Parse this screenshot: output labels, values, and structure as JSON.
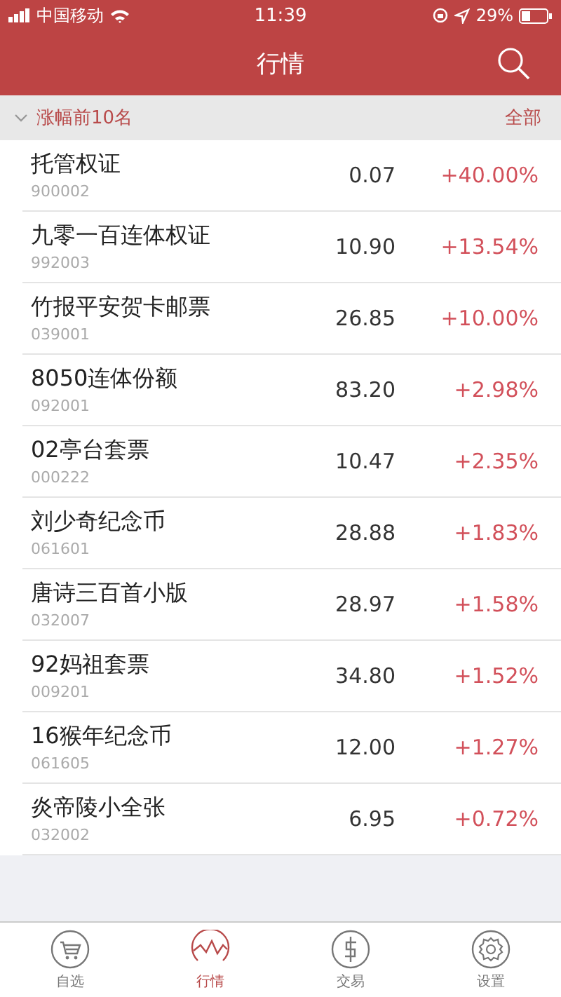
{
  "status_bar": {
    "carrier": "中国移动",
    "time": "11:39",
    "battery": "29%"
  },
  "header": {
    "title": "行情"
  },
  "section": {
    "title": "涨幅前10名",
    "expanded": true,
    "action": "全部"
  },
  "rows": [
    {
      "name": "托管权证",
      "code": "900002",
      "price": "0.07",
      "change": "+40.00%"
    },
    {
      "name": "九零一百连体权证",
      "code": "992003",
      "price": "10.90",
      "change": "+13.54%"
    },
    {
      "name": "竹报平安贺卡邮票",
      "code": "039001",
      "price": "26.85",
      "change": "+10.00%"
    },
    {
      "name": "8050连体份额",
      "code": "092001",
      "price": "83.20",
      "change": "+2.98%"
    },
    {
      "name": "02亭台套票",
      "code": "000222",
      "price": "10.47",
      "change": "+2.35%"
    },
    {
      "name": "刘少奇纪念币",
      "code": "061601",
      "price": "28.88",
      "change": "+1.83%"
    },
    {
      "name": "唐诗三百首小版",
      "code": "032007",
      "price": "28.97",
      "change": "+1.58%"
    },
    {
      "name": "92妈祖套票",
      "code": "009201",
      "price": "34.80",
      "change": "+1.52%"
    },
    {
      "name": "16猴年纪念币",
      "code": "061605",
      "price": "12.00",
      "change": "+1.27%"
    },
    {
      "name": "炎帝陵小全张",
      "code": "032002",
      "price": "6.95",
      "change": "+0.72%"
    }
  ],
  "tabs": [
    {
      "kind": "cart",
      "label": "自选",
      "selected": false
    },
    {
      "kind": "chart",
      "label": "行情",
      "selected": true
    },
    {
      "kind": "dollar",
      "label": "交易",
      "selected": false
    },
    {
      "kind": "gear",
      "label": "设置",
      "selected": false
    }
  ]
}
